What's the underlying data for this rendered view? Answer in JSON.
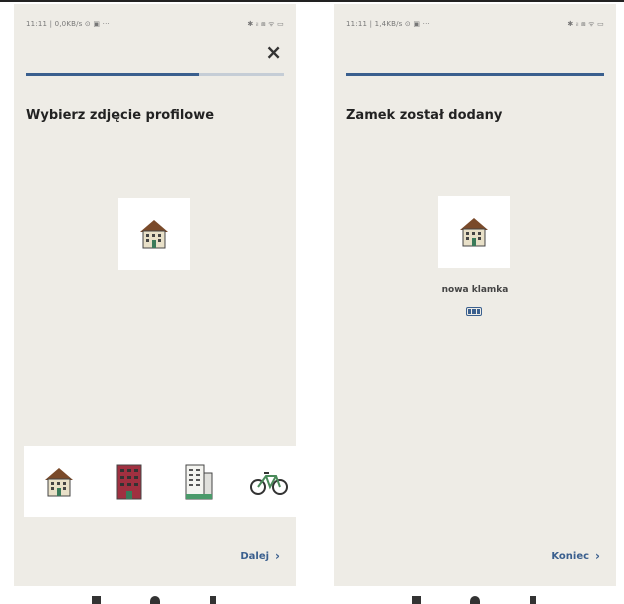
{
  "left_screen": {
    "status_left": "11:11 | 0,0KB/s ⊙ ▣ ···",
    "status_right": "✱ ᵢₗ ⧈ ᯤ ▭",
    "close_label": "×",
    "progress_fraction": 0.67,
    "title": "Wybierz zdjęcie profilowe",
    "strip_icons": [
      "house-icon",
      "red-building-icon",
      "office-building-icon",
      "bicycle-icon"
    ],
    "next_label": "Dalej",
    "next_chevron": "›"
  },
  "right_screen": {
    "status_left": "11:11 | 1,4KB/s ⊙ ▣ ···",
    "status_right": "✱ ᵢₗ ⧈ ᯤ ▭",
    "progress_fraction": 1.0,
    "title": "Zamek został dodany",
    "device_name": "nowa klamka",
    "finish_label": "Koniec",
    "finish_chevron": "›"
  },
  "colors": {
    "accent": "#3a5f8e",
    "background": "#eeece6"
  }
}
